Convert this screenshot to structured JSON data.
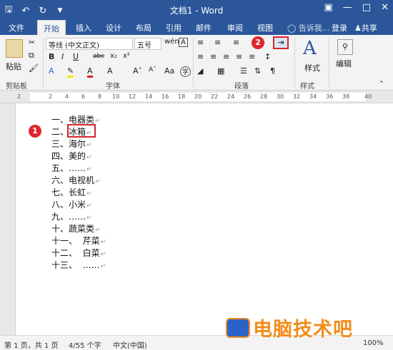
{
  "titlebar": {
    "title": "文档1 - Word",
    "qat": [
      "save-icon",
      "undo-icon",
      "redo-icon",
      "customize-icon"
    ],
    "controls": [
      "ribbon-options-icon",
      "minimize-icon",
      "restore-icon",
      "close-icon"
    ]
  },
  "tabs": {
    "items": [
      "文件",
      "开始",
      "插入",
      "设计",
      "布局",
      "引用",
      "邮件",
      "审阅",
      "视图"
    ],
    "active": "开始",
    "tell_me": "告诉我...",
    "signin": "登录",
    "share": "共享"
  },
  "ribbon": {
    "paste_label": "粘贴",
    "font_name": "等线 (中文正文)",
    "font_size": "五号",
    "groups": {
      "clipboard": "剪贴板",
      "font": "字体",
      "paragraph": "段落",
      "styles": "样式",
      "styles_button": "样式",
      "editing_button": "编辑"
    },
    "font_buttons": [
      "B",
      "I",
      "U",
      "abc",
      "x₂",
      "x²"
    ]
  },
  "ruler": {
    "ticks": [
      "2",
      "2",
      "4",
      "6",
      "8",
      "10",
      "12",
      "14",
      "16",
      "18",
      "20",
      "22",
      "24",
      "26",
      "28",
      "30",
      "32",
      "34",
      "36",
      "38",
      "40"
    ]
  },
  "document": {
    "lines": [
      "一、电器类",
      "二、冰箱",
      "三、海尔",
      "四、美的",
      "五、……",
      "六、电视机",
      "七、长虹",
      "八、小米",
      "九、……",
      "十、蔬菜类",
      "十一、  芹菜",
      "十二、  白菜",
      "十三、  ……"
    ],
    "paragraph_mark": "↵"
  },
  "annotations": {
    "badge1": "1",
    "badge2": "2"
  },
  "status": {
    "page": "第 1 页，共 1 页",
    "words": "4/55 个字",
    "language": "中文(中国)",
    "zoom": "100%"
  },
  "watermark": {
    "text": "电脑技术吧"
  }
}
